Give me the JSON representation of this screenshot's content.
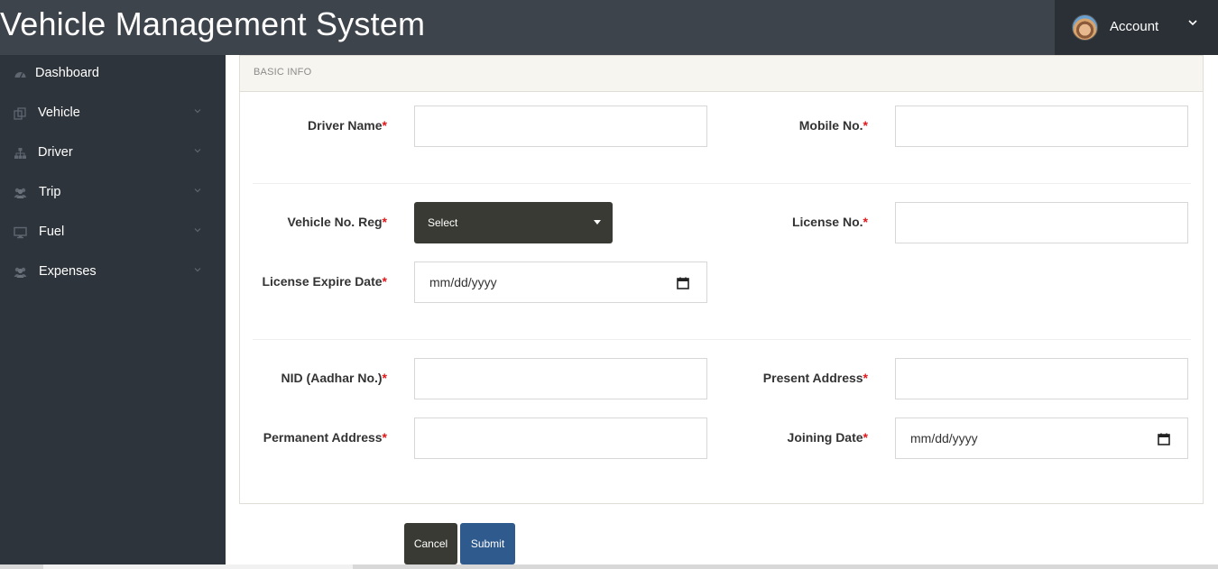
{
  "header": {
    "app_title": "Vehicle Management System",
    "account_label": "Account"
  },
  "sidebar": {
    "items": [
      {
        "label": "Dashboard",
        "icon": "dashboard-icon"
      },
      {
        "label": "Vehicle",
        "icon": "copy-icon"
      },
      {
        "label": "Driver",
        "icon": "sitemap-icon"
      },
      {
        "label": "Trip",
        "icon": "users-icon"
      },
      {
        "label": "Fuel",
        "icon": "desktop-icon"
      },
      {
        "label": "Expenses",
        "icon": "users-icon"
      }
    ]
  },
  "form": {
    "section_title": "BASIC INFO",
    "required_mark": "*",
    "driver_name": {
      "label": "Driver Name",
      "value": ""
    },
    "mobile_no": {
      "label": "Mobile No.",
      "value": ""
    },
    "vehicle_no_reg": {
      "label": "Vehicle No. Reg",
      "selected": "Select"
    },
    "license_no": {
      "label": "License No.",
      "value": ""
    },
    "license_expire_date": {
      "label": "License Expire Date",
      "value": "mm/dd/yyyy"
    },
    "nid": {
      "label": "NID (Aadhar No.)",
      "value": ""
    },
    "present_address": {
      "label": "Present Address",
      "value": ""
    },
    "permanent_address": {
      "label": "Permanent Address",
      "value": ""
    },
    "joining_date": {
      "label": "Joining Date",
      "value": "mm/dd/yyyy"
    }
  },
  "actions": {
    "cancel_label": "Cancel",
    "submit_label": "Submit"
  },
  "colors": {
    "header_bg": "#3e444c",
    "sidebar_bg": "#2e343b",
    "required": "#e0181b",
    "submit_bg": "#2f5a8e",
    "dark_button_bg": "#3a3a34"
  }
}
